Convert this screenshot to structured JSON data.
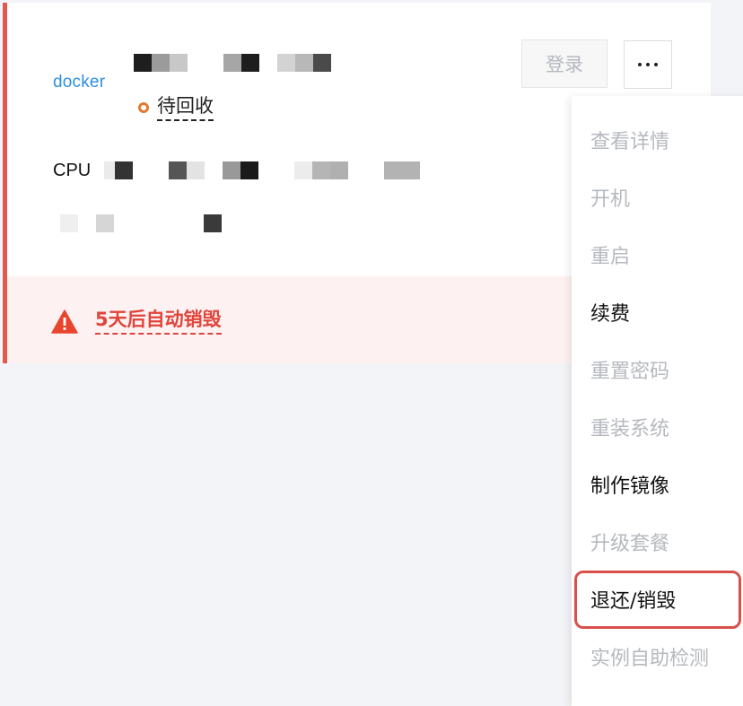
{
  "colors": {
    "accent_red": "#e0594f",
    "warning_red": "#e0443b",
    "status_orange": "#e37b32",
    "docker_blue": "#2e8fe0",
    "disabled_gray": "#b6b9bf",
    "highlight_border": "#d9504b"
  },
  "instance": {
    "brand_logo": "docker",
    "status": {
      "icon": "status-ring-icon",
      "text": "待回收"
    },
    "cpu_label": "CPU",
    "login_button": "登录",
    "more_button_icon": "more-dots-icon",
    "warning": {
      "icon": "warning-triangle-icon",
      "text": "5天后自动销毁"
    }
  },
  "dropdown": {
    "items": [
      {
        "label": "查看详情",
        "enabled": false
      },
      {
        "label": "开机",
        "enabled": false
      },
      {
        "label": "重启",
        "enabled": false
      },
      {
        "label": "续费",
        "enabled": true
      },
      {
        "label": "重置密码",
        "enabled": false
      },
      {
        "label": "重装系统",
        "enabled": false
      },
      {
        "label": "制作镜像",
        "enabled": true
      },
      {
        "label": "升级套餐",
        "enabled": false
      },
      {
        "label": "退还/销毁",
        "enabled": true,
        "highlighted": true
      },
      {
        "label": "实例自助检测",
        "enabled": false
      }
    ]
  }
}
